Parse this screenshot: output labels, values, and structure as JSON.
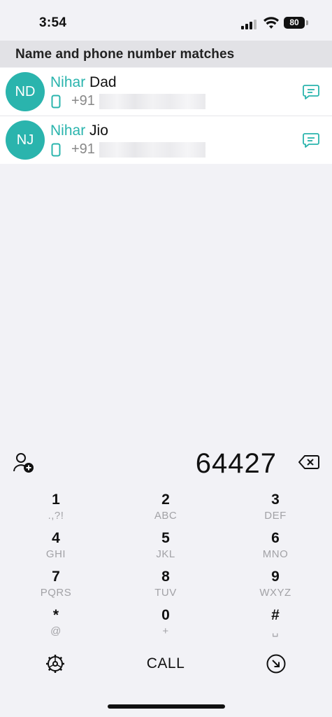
{
  "status_bar": {
    "time": "3:54",
    "battery": "80"
  },
  "section_header": "Name and phone number matches",
  "contacts": [
    {
      "initials": "ND",
      "name_match": "Nihar",
      "name_rest": " Dad",
      "number_prefix": "+91"
    },
    {
      "initials": "NJ",
      "name_match": "Nihar",
      "name_rest": " Jio",
      "number_prefix": "+91"
    }
  ],
  "dialer": {
    "input": "64427",
    "keys": [
      {
        "digit": "1",
        "letters": ".,?!"
      },
      {
        "digit": "2",
        "letters": "ABC"
      },
      {
        "digit": "3",
        "letters": "DEF"
      },
      {
        "digit": "4",
        "letters": "GHI"
      },
      {
        "digit": "5",
        "letters": "JKL"
      },
      {
        "digit": "6",
        "letters": "MNO"
      },
      {
        "digit": "7",
        "letters": "PQRS"
      },
      {
        "digit": "8",
        "letters": "TUV"
      },
      {
        "digit": "9",
        "letters": "WXYZ"
      },
      {
        "digit": "*",
        "letters": "@"
      },
      {
        "digit": "0",
        "letters": "+"
      },
      {
        "digit": "#",
        "letters": "␣"
      }
    ],
    "call_label": "CALL"
  },
  "icons": {
    "accent_color": "#2ab4ad",
    "add_contact": "add-contact-icon",
    "backspace": "backspace-icon",
    "settings": "settings-wheel-icon",
    "shortcut": "arrow-down-right-circle-icon",
    "message": "message-icon",
    "phone": "mobile-phone-icon"
  }
}
